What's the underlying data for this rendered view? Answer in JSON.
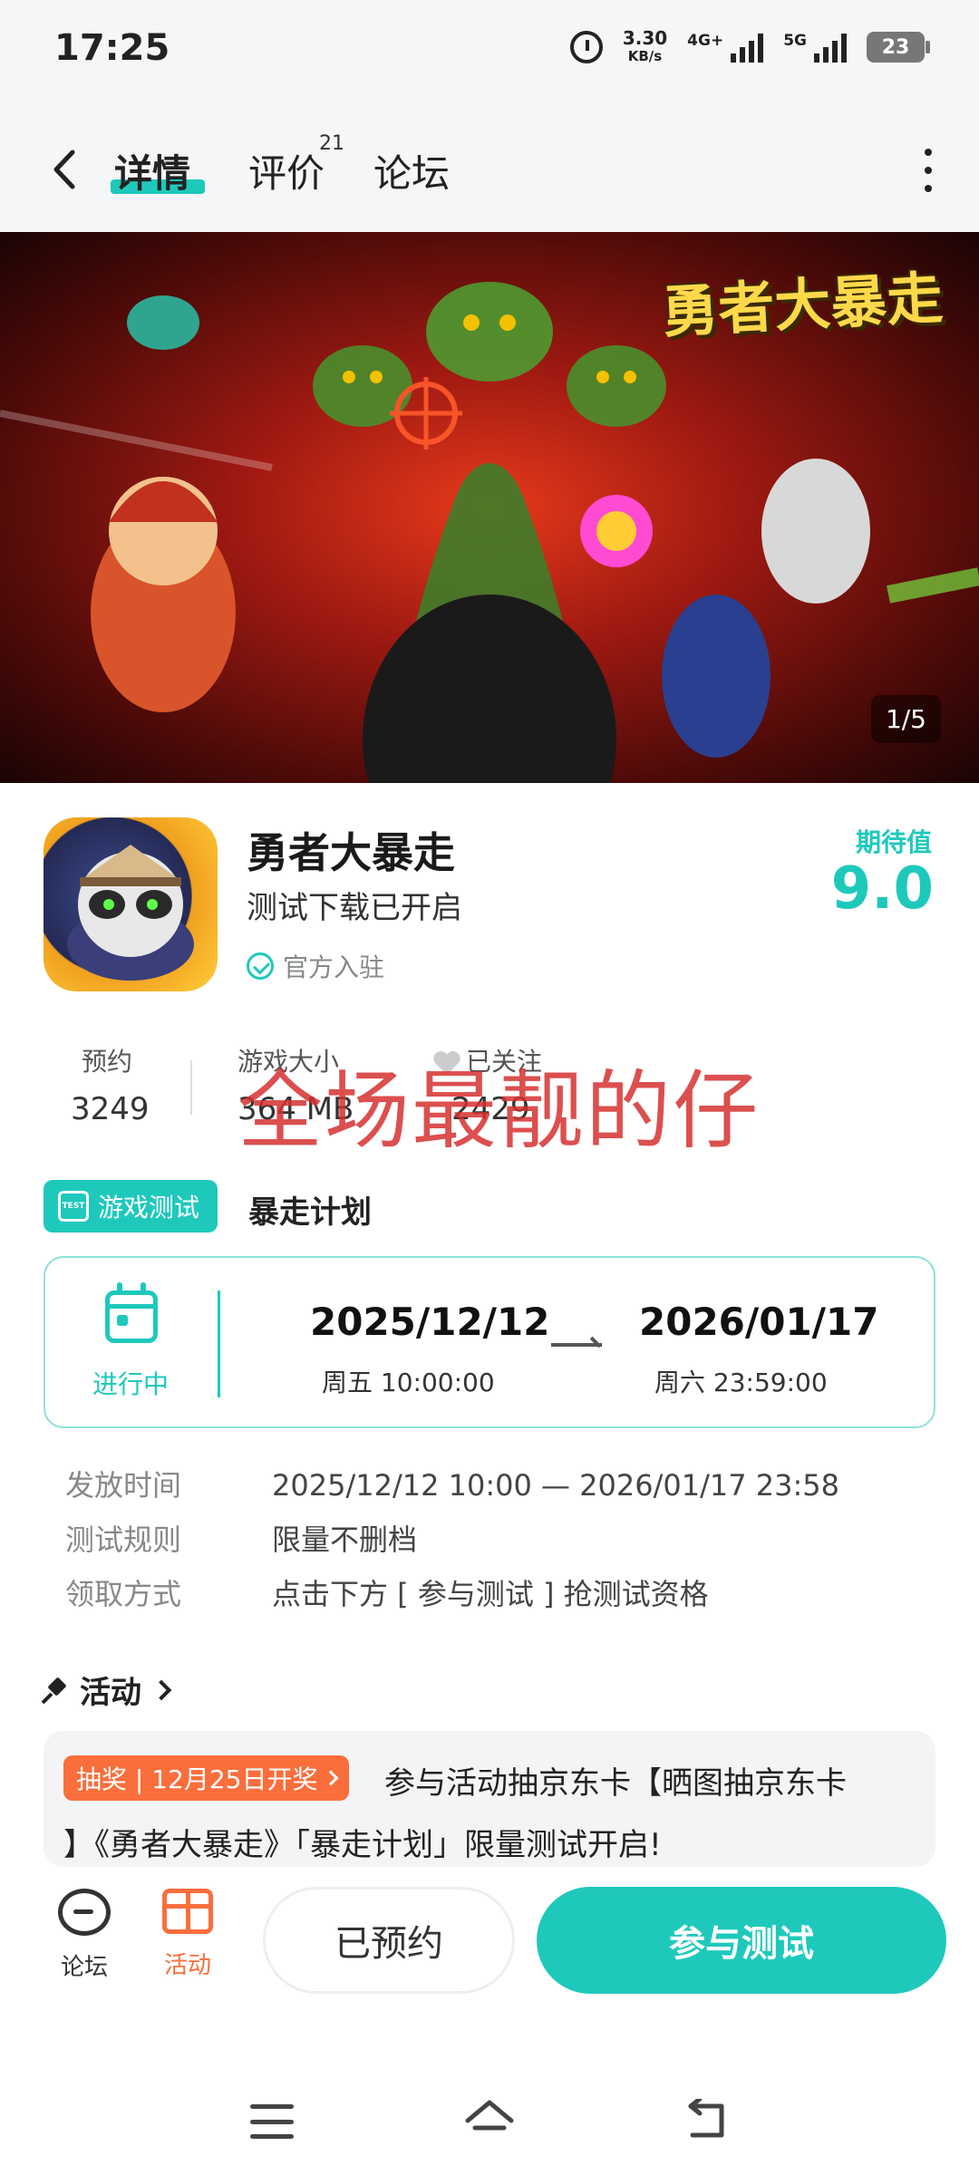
{
  "status_bar": {
    "time": "17:25",
    "speed_value": "3.30",
    "speed_unit": "KB/s",
    "net1": "4G+",
    "net2": "5G",
    "battery": "23"
  },
  "header": {
    "tabs": [
      {
        "label": "详情",
        "active": true
      },
      {
        "label": "评价",
        "badge": "21"
      },
      {
        "label": "论坛"
      }
    ]
  },
  "banner": {
    "logo_text": "勇者大暴走",
    "pager": "1/5"
  },
  "app": {
    "name": "勇者大暴走",
    "subtitle": "测试下载已开启",
    "official": "官方入驻",
    "expect_label": "期待值",
    "expect_value": "9.0"
  },
  "stats": [
    {
      "label": "预约",
      "value": "3249"
    },
    {
      "label": "游戏大小",
      "value": "364 MB"
    },
    {
      "label": "已关注",
      "value": "2429"
    }
  ],
  "watermark": "全场最靓的仔",
  "test": {
    "badge": "游戏测试",
    "badge_icon_text": "TEST",
    "title": "暴走计划",
    "status": "进行中",
    "start_date": "2025/12/12",
    "start_time": "周五  10:00:00",
    "end_date": "2026/01/17",
    "end_time": "周六  23:59:00",
    "info": [
      {
        "key": "发放时间",
        "value": "2025/12/12 10:00 — 2026/01/17 23:58"
      },
      {
        "key": "测试规则",
        "value": "限量不删档"
      },
      {
        "key": "领取方式",
        "value": "点击下方 [ 参与测试 ] 抢测试资格"
      }
    ]
  },
  "activity": {
    "title": "活动",
    "tag": "抽奖 | 12月25日开奖",
    "line1": "参与活动抽京东卡【晒图抽京东卡",
    "line2": "】《勇者大暴走》「暴走计划」限量测试开启!"
  },
  "bottom_bar": {
    "forum_label": "论坛",
    "activity_label": "活动",
    "reserved_label": "已预约",
    "join_label": "参与测试"
  },
  "colors": {
    "accent": "#1ec9bc",
    "orange": "#fa6e3c",
    "watermark": "#d63030"
  }
}
